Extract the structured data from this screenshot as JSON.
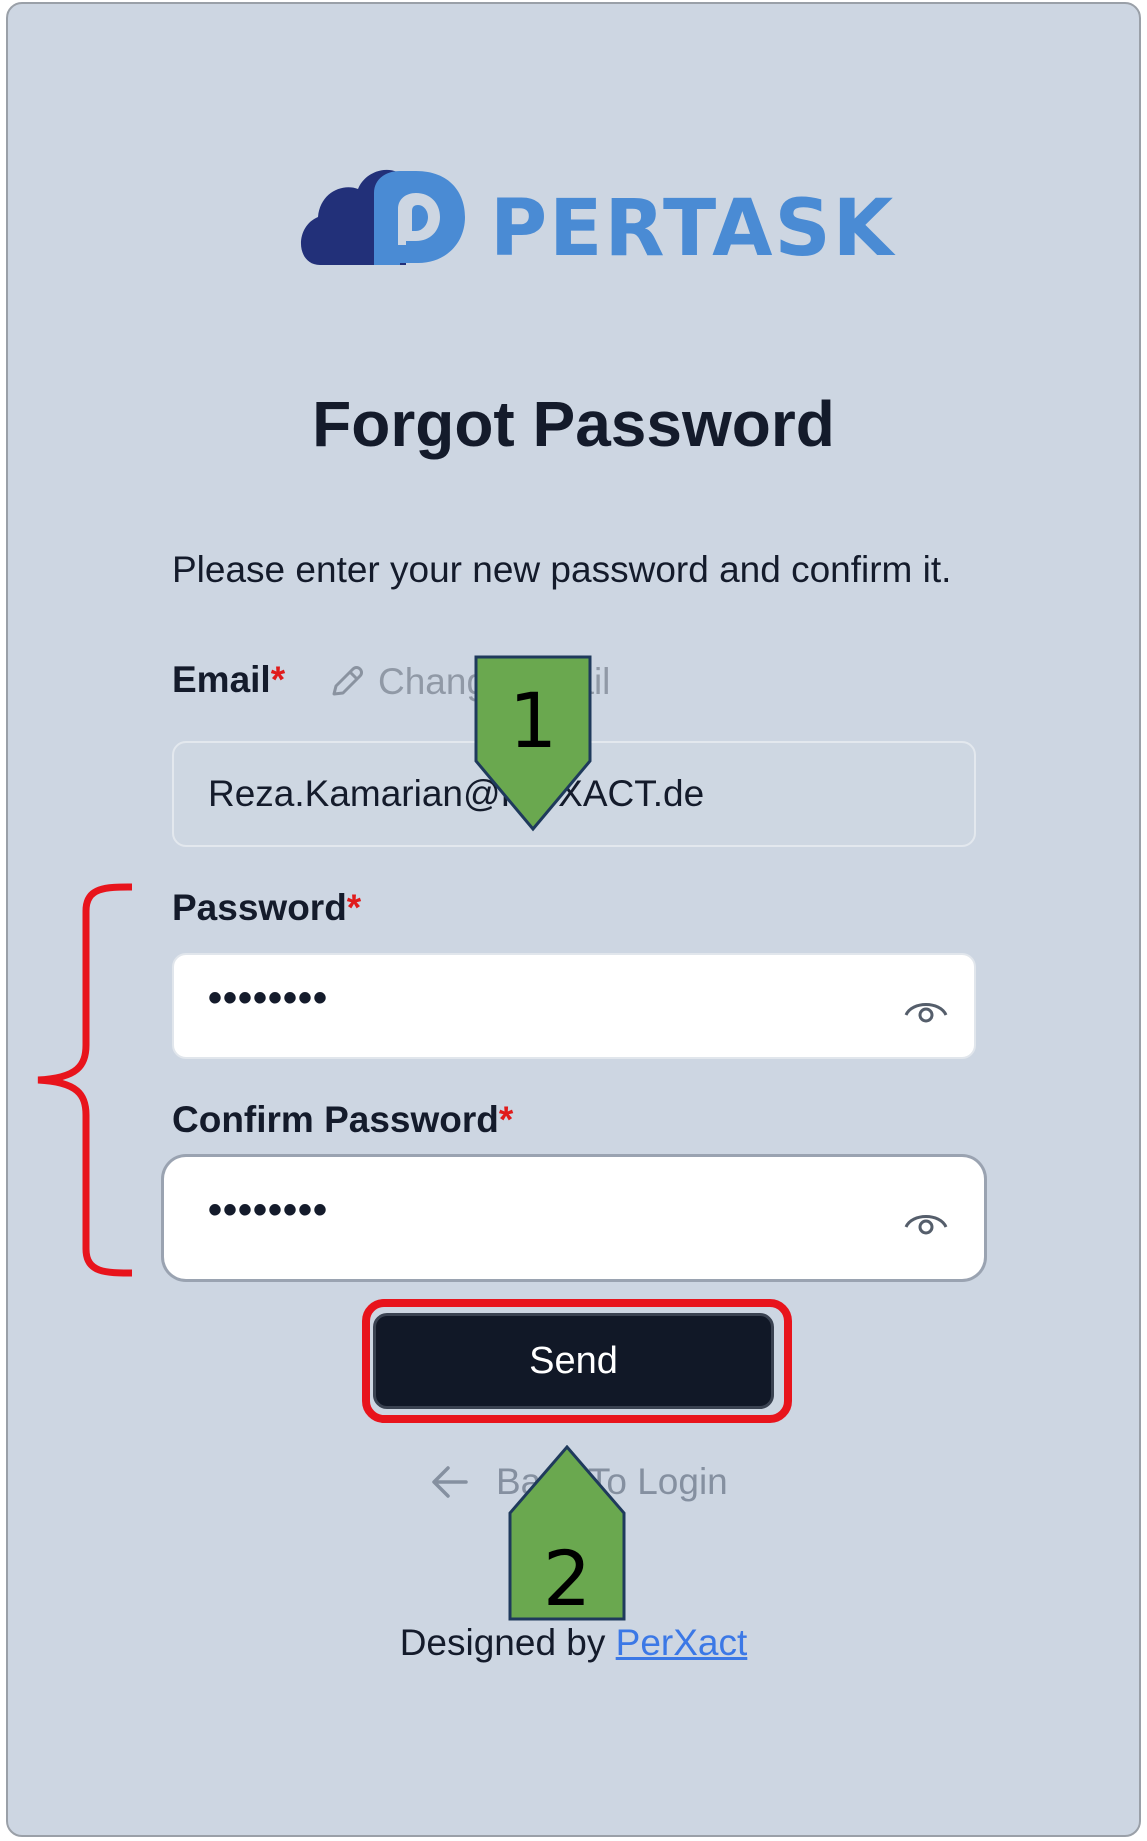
{
  "brand": {
    "name": "PERTASK",
    "dark_color": "#223079",
    "accent_color": "#4a8bd4"
  },
  "page": {
    "title": "Forgot Password",
    "subtitle": "Please enter your new password and confirm it."
  },
  "form": {
    "email": {
      "label": "Email",
      "required_mark": "*",
      "change_link": "Change Email",
      "value": "Reza.Kamarian@PerXACT.de"
    },
    "password": {
      "label": "Password",
      "required_mark": "*",
      "value": "••••••••"
    },
    "confirm_password": {
      "label": "Confirm Password",
      "required_mark": "*",
      "value": "••••••••"
    },
    "send_label": "Send",
    "back_label": "Back To Login"
  },
  "footer": {
    "prefix": "Designed by",
    "link": "PerXact"
  },
  "annotations": {
    "callout_1": "1",
    "callout_2": "2",
    "highlight_color": "#e8141c",
    "callout_color": "#6aa84f"
  }
}
